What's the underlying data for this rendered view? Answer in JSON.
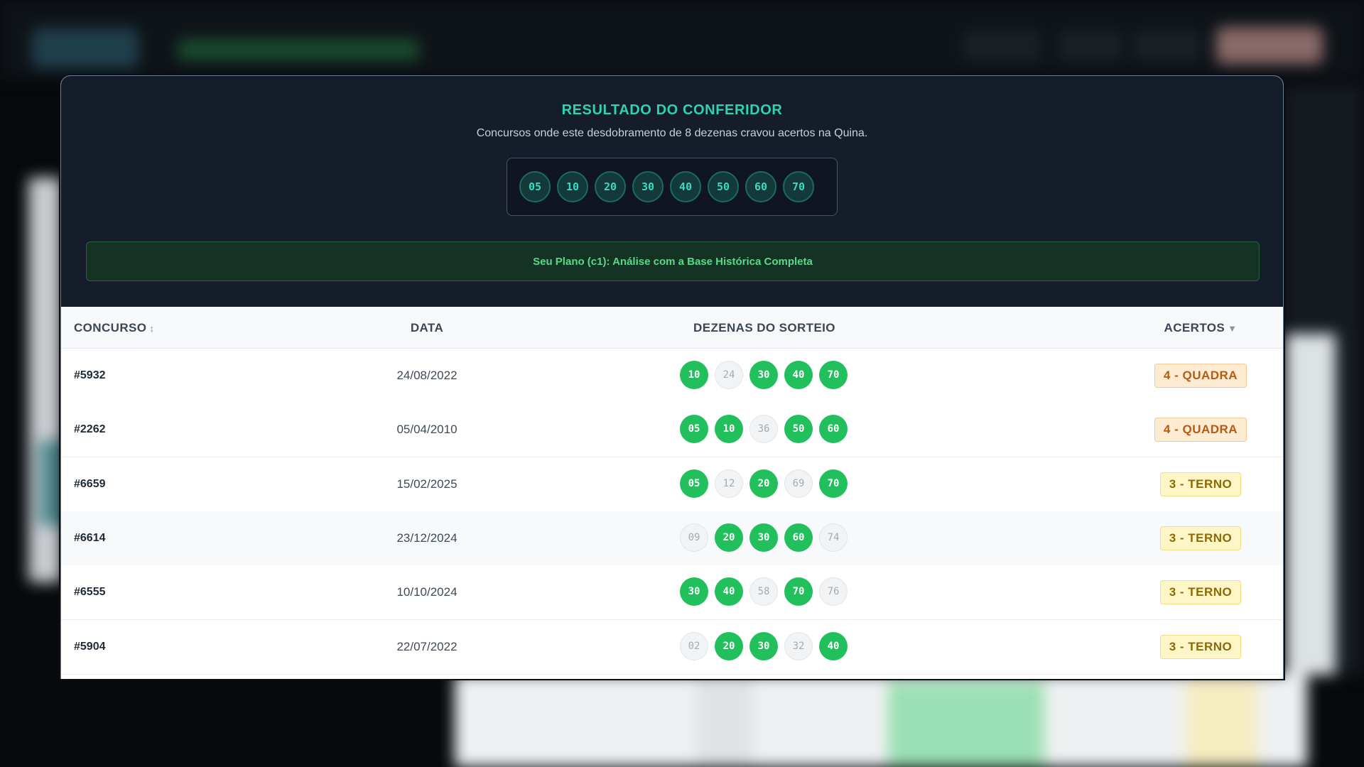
{
  "modal": {
    "title": "RESULTADO DO CONFERIDOR",
    "subtitle": "Concursos onde este desdobramento de 8 dezenas cravou acertos na Quina.",
    "combination": [
      "05",
      "10",
      "20",
      "30",
      "40",
      "50",
      "60",
      "70"
    ],
    "plan_banner": "Seu Plano (c1): Análise com a Base Histórica Completa"
  },
  "table": {
    "headers": {
      "concurso": "CONCURSO",
      "concurso_sort_icon": "↕",
      "data": "DATA",
      "dezenas": "DEZENAS DO SORTEIO",
      "acertos": "ACERTOS",
      "acertos_sort_icon": "▼"
    },
    "rows": [
      {
        "concurso": "#5932",
        "data": "24/08/2022",
        "balls": [
          {
            "n": "10",
            "hit": true
          },
          {
            "n": "24",
            "hit": false
          },
          {
            "n": "30",
            "hit": true
          },
          {
            "n": "40",
            "hit": true
          },
          {
            "n": "70",
            "hit": true
          }
        ],
        "acertos": "4 - QUADRA",
        "level": "quadra"
      },
      {
        "concurso": "#2262",
        "data": "05/04/2010",
        "balls": [
          {
            "n": "05",
            "hit": true
          },
          {
            "n": "10",
            "hit": true
          },
          {
            "n": "36",
            "hit": false
          },
          {
            "n": "50",
            "hit": true
          },
          {
            "n": "60",
            "hit": true
          }
        ],
        "acertos": "4 - QUADRA",
        "level": "quadra"
      },
      {
        "concurso": "#6659",
        "data": "15/02/2025",
        "balls": [
          {
            "n": "05",
            "hit": true
          },
          {
            "n": "12",
            "hit": false
          },
          {
            "n": "20",
            "hit": true
          },
          {
            "n": "69",
            "hit": false
          },
          {
            "n": "70",
            "hit": true
          }
        ],
        "acertos": "3 - TERNO",
        "level": "terno"
      },
      {
        "concurso": "#6614",
        "data": "23/12/2024",
        "balls": [
          {
            "n": "09",
            "hit": false
          },
          {
            "n": "20",
            "hit": true
          },
          {
            "n": "30",
            "hit": true
          },
          {
            "n": "60",
            "hit": true
          },
          {
            "n": "74",
            "hit": false
          }
        ],
        "acertos": "3 - TERNO",
        "level": "terno"
      },
      {
        "concurso": "#6555",
        "data": "10/10/2024",
        "balls": [
          {
            "n": "30",
            "hit": true
          },
          {
            "n": "40",
            "hit": true
          },
          {
            "n": "58",
            "hit": false
          },
          {
            "n": "70",
            "hit": true
          },
          {
            "n": "76",
            "hit": false
          }
        ],
        "acertos": "3 - TERNO",
        "level": "terno"
      },
      {
        "concurso": "#5904",
        "data": "22/07/2022",
        "balls": [
          {
            "n": "02",
            "hit": false
          },
          {
            "n": "20",
            "hit": true
          },
          {
            "n": "30",
            "hit": true
          },
          {
            "n": "32",
            "hit": false
          },
          {
            "n": "40",
            "hit": true
          }
        ],
        "acertos": "3 - TERNO",
        "level": "terno"
      }
    ]
  },
  "colors": {
    "accent": "#2ed3b0",
    "hit_ball": "#21c05d",
    "header_bg": "#151d2b",
    "quadra": "#b85a12",
    "terno": "#8a6a08"
  }
}
